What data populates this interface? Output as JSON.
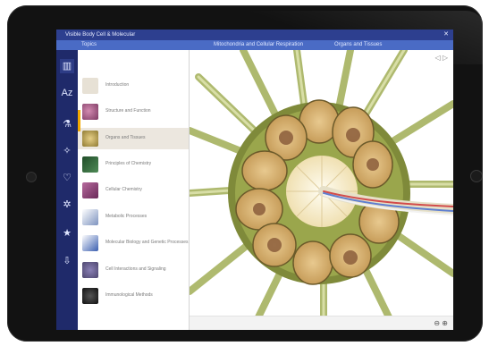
{
  "app": {
    "title": "Visible Body Cell & Molecular",
    "close_icon": "close-icon"
  },
  "tabs": [
    "Topics",
    "Mitochondria and Cellular Respiration",
    "Organs and Tissues"
  ],
  "rail_icons": [
    {
      "name": "library-icon",
      "glyph": "▥",
      "active": true
    },
    {
      "name": "glossary-icon",
      "glyph": "Aᴢ",
      "active": false
    },
    {
      "name": "microscope-icon",
      "glyph": "⚗",
      "active": false
    },
    {
      "name": "lightbulb-icon",
      "glyph": "✧",
      "active": false
    },
    {
      "name": "heartbeat-icon",
      "glyph": "♡",
      "active": false
    },
    {
      "name": "settings-icon",
      "glyph": "✲",
      "active": false
    },
    {
      "name": "star-icon",
      "glyph": "★",
      "active": false
    },
    {
      "name": "download-icon",
      "glyph": "⇩",
      "active": false
    }
  ],
  "topics": [
    {
      "label": "Introduction",
      "color": "#d9d2c5"
    },
    {
      "label": "Structure and Function",
      "color": "#b06c8f"
    },
    {
      "label": "Organs and Tissues",
      "color": "#b9a35a",
      "active": true
    },
    {
      "label": "Principles of Chemistry",
      "color": "#2f6d3b"
    },
    {
      "label": "Cellular Chemistry",
      "color": "#8b3f73"
    },
    {
      "label": "Metabolic Processes",
      "color": "#6d86b0"
    },
    {
      "label": "Molecular Biology and Genetic Processes",
      "color": "#3b5fb0"
    },
    {
      "label": "Cell Interactions and Signaling",
      "color": "#6d6390"
    },
    {
      "label": "Immunological Methods",
      "color": "#3a3a3a"
    }
  ],
  "viewer": {
    "nav": "◁ ▷",
    "zoom": "⊖ ⊕"
  },
  "colors": {
    "accent": "#f2a900",
    "rail": "#1f2a6a",
    "tabbar": "#4a6bc5"
  }
}
